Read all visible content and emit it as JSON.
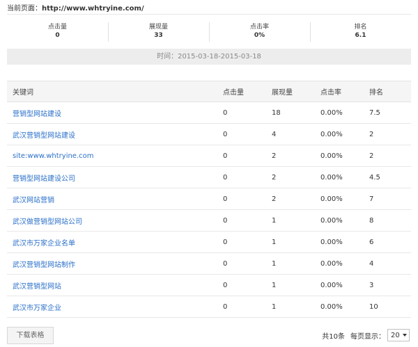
{
  "header": {
    "current_page_label": "当前页面：",
    "current_page_url": "http://www.whtryine.com/"
  },
  "summary": [
    {
      "label": "点击量",
      "value": "0"
    },
    {
      "label": "展现量",
      "value": "33"
    },
    {
      "label": "点击率",
      "value": "0%"
    },
    {
      "label": "排名",
      "value": "6.1"
    }
  ],
  "date_range": "时间：2015-03-18-2015-03-18",
  "table": {
    "columns": [
      "关键词",
      "点击量",
      "展现量",
      "点击率",
      "排名"
    ],
    "rows": [
      {
        "keyword": "营销型网站建设",
        "clicks": "0",
        "impressions": "18",
        "ctr": "0.00%",
        "rank": "7.5"
      },
      {
        "keyword": "武汉营销型网站建设",
        "clicks": "0",
        "impressions": "4",
        "ctr": "0.00%",
        "rank": "2"
      },
      {
        "keyword": "site:www.whtryine.com",
        "clicks": "0",
        "impressions": "2",
        "ctr": "0.00%",
        "rank": "2"
      },
      {
        "keyword": "营销型网站建设公司",
        "clicks": "0",
        "impressions": "2",
        "ctr": "0.00%",
        "rank": "4.5"
      },
      {
        "keyword": "武汉网站营销",
        "clicks": "0",
        "impressions": "2",
        "ctr": "0.00%",
        "rank": "7"
      },
      {
        "keyword": "武汉做营销型网站公司",
        "clicks": "0",
        "impressions": "1",
        "ctr": "0.00%",
        "rank": "8"
      },
      {
        "keyword": "武汉市万家企业名单",
        "clicks": "0",
        "impressions": "1",
        "ctr": "0.00%",
        "rank": "6"
      },
      {
        "keyword": "武汉营销型网站制作",
        "clicks": "0",
        "impressions": "1",
        "ctr": "0.00%",
        "rank": "4"
      },
      {
        "keyword": "武汉营销型网站",
        "clicks": "0",
        "impressions": "1",
        "ctr": "0.00%",
        "rank": "3"
      },
      {
        "keyword": "武汉市万家企业",
        "clicks": "0",
        "impressions": "1",
        "ctr": "0.00%",
        "rank": "10"
      }
    ]
  },
  "footer": {
    "download_label": "下载表格",
    "total_label": "共10条",
    "per_page_label": "每页显示：",
    "per_page_value": "20"
  },
  "colors": {
    "link": "#2a6fc9",
    "header_bg": "#f5f5f5",
    "date_bar_bg": "#ededed"
  }
}
